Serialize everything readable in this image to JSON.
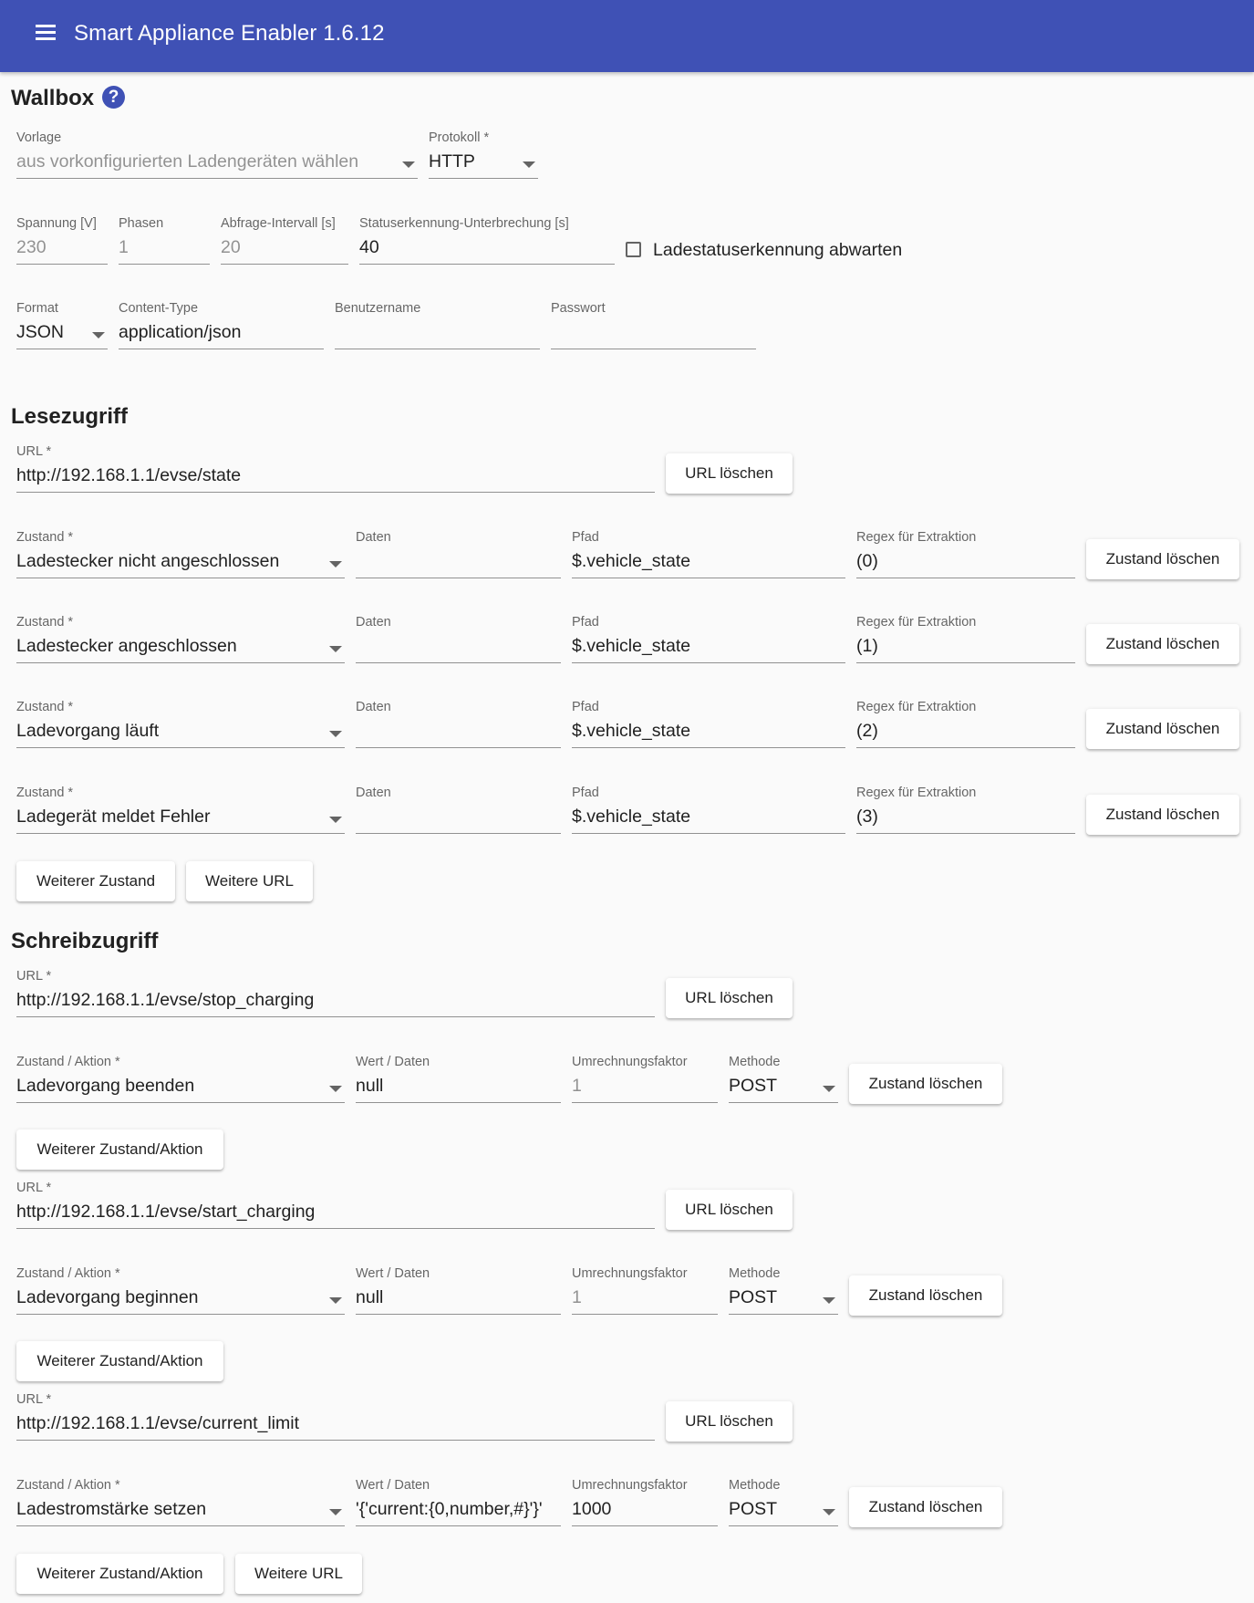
{
  "header": {
    "menu_icon": "hamburger-menu-icon",
    "title": "Smart Appliance Enabler 1.6.12"
  },
  "page": {
    "title": "Wallbox",
    "help_icon": "help-circle-icon",
    "help_glyph": "?"
  },
  "general": {
    "vorlage": {
      "label": "Vorlage",
      "value": "aus vorkonfigurierten Ladengeräten wählen"
    },
    "protokoll": {
      "label": "Protokoll *",
      "value": "HTTP"
    },
    "spannung": {
      "label": "Spannung [V]",
      "placeholder": "230"
    },
    "phasen": {
      "label": "Phasen",
      "placeholder": "1"
    },
    "intervall": {
      "label": "Abfrage-Intervall [s]",
      "placeholder": "20"
    },
    "unterbrechung": {
      "label": "Statuserkennung-Unterbrechung [s]",
      "value": "40"
    },
    "abwarten": {
      "label": "Ladestatuserkennung abwarten",
      "checked": false
    },
    "format": {
      "label": "Format",
      "value": "JSON"
    },
    "content_type": {
      "label": "Content-Type",
      "value": "application/json"
    },
    "benutzername": {
      "label": "Benutzername",
      "value": ""
    },
    "passwort": {
      "label": "Passwort",
      "value": ""
    }
  },
  "read": {
    "title": "Lesezugriff",
    "url_label": "URL *",
    "url": "http://192.168.1.1/evse/state",
    "url_delete": "URL löschen",
    "col_state": "Zustand *",
    "col_data": "Daten",
    "col_path": "Pfad",
    "col_regex": "Regex für Extraktion",
    "state_delete": "Zustand löschen",
    "rows": [
      {
        "state": "Ladestecker nicht angeschlossen",
        "data": "",
        "path": "$.vehicle_state",
        "regex": "(0)"
      },
      {
        "state": "Ladestecker angeschlossen",
        "data": "",
        "path": "$.vehicle_state",
        "regex": "(1)"
      },
      {
        "state": "Ladevorgang läuft",
        "data": "",
        "path": "$.vehicle_state",
        "regex": "(2)"
      },
      {
        "state": "Ladegerät meldet Fehler",
        "data": "",
        "path": "$.vehicle_state",
        "regex": "(3)"
      }
    ],
    "add_state": "Weiterer Zustand",
    "add_url": "Weitere URL"
  },
  "write": {
    "title": "Schreibzugriff",
    "url_label": "URL *",
    "url_delete": "URL löschen",
    "col_action": "Zustand / Aktion *",
    "col_value": "Wert / Daten",
    "col_factor": "Umrechnungsfaktor",
    "col_method": "Methode",
    "state_delete": "Zustand löschen",
    "add_action": "Weiterer Zustand/Aktion",
    "add_url": "Weitere URL",
    "blocks": [
      {
        "url": "http://192.168.1.1/evse/stop_charging",
        "action": "Ladevorgang beenden",
        "value": "null",
        "factor": "",
        "factor_placeholder": "1",
        "method": "POST"
      },
      {
        "url": "http://192.168.1.1/evse/start_charging",
        "action": "Ladevorgang beginnen",
        "value": "null",
        "factor": "",
        "factor_placeholder": "1",
        "method": "POST"
      },
      {
        "url": "http://192.168.1.1/evse/current_limit",
        "action": "Ladestromstärke setzen",
        "value": "'{'current:{0,number,#}'}'",
        "factor": "1000",
        "factor_placeholder": "1",
        "method": "POST"
      }
    ]
  }
}
